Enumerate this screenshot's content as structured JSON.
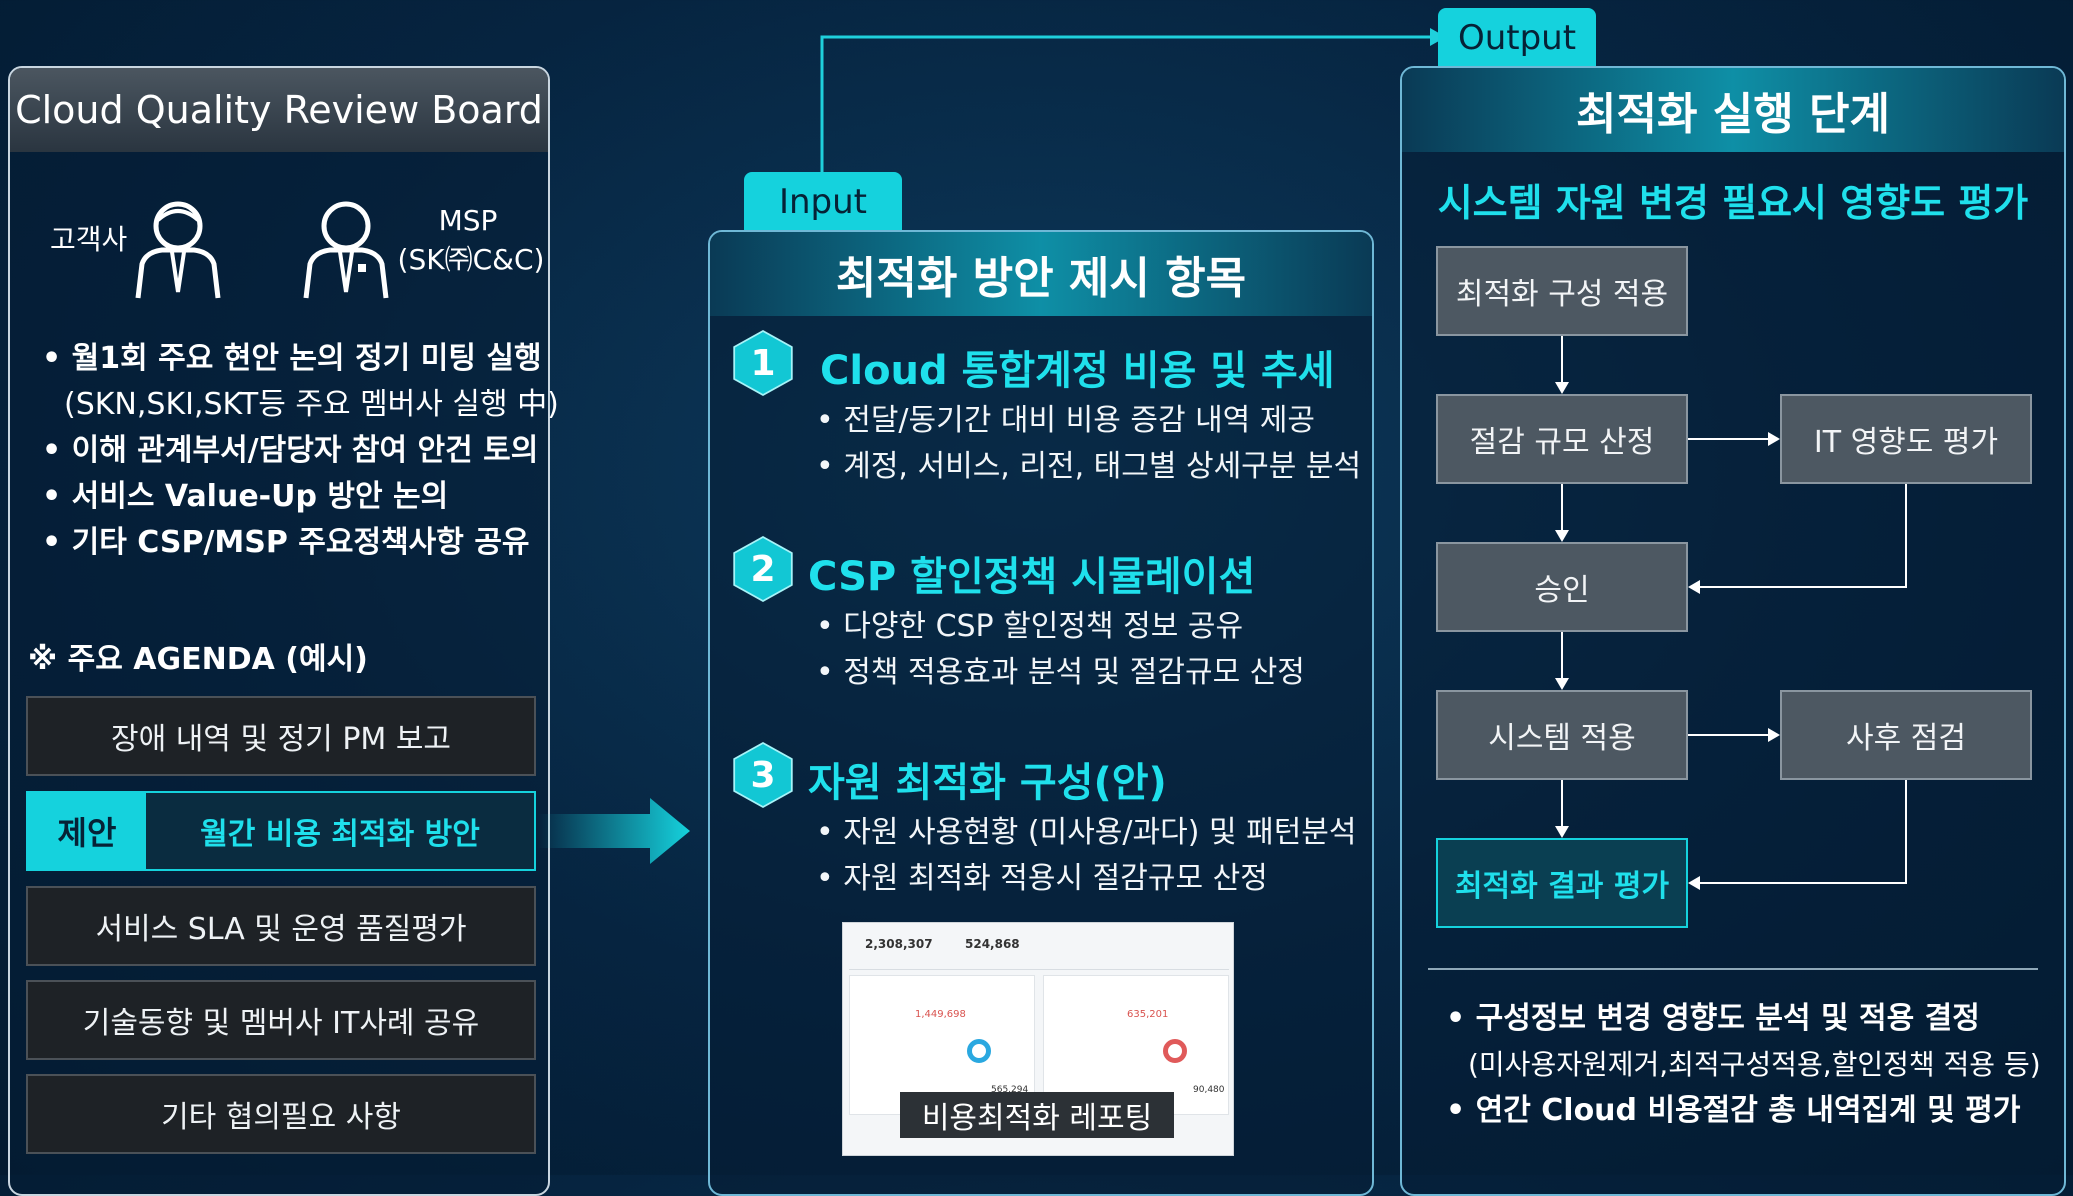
{
  "left": {
    "title": "Cloud Quality Review Board",
    "customer_label": "고객사",
    "msp_label": "MSP",
    "msp_sub": "(SK㈜C&C)",
    "bullets": [
      "• 월1회 주요 현안 논의 정기 미팅 실행",
      "(SKN,SKI,SKT등 주요 멤버사 실행 中)",
      "• 이해 관계부서/담당자 참여 안건 토의",
      "• 서비스 Value-Up 방안 논의",
      "• 기타 CSP/MSP 주요정책사항 공유"
    ],
    "agenda_title": "※ 주요 AGENDA (예시)",
    "agenda": [
      "장애 내역 및 정기 PM 보고",
      "월간 비용 최적화 방안",
      "서비스 SLA 및 운영 품질평가",
      "기술동향 및 멤버사 IT사례 공유",
      "기타 협의필요 사항"
    ],
    "proposal_tag": "제안"
  },
  "middle": {
    "tab": "Input",
    "title": "최적화 방안 제시 항목",
    "sections": [
      {
        "num": "1",
        "head": "Cloud 통합계정 비용 및 추세",
        "items": [
          "• 전달/동기간 대비 비용 증감 내역 제공",
          "• 계정, 서비스, 리전, 태그별 상세구분 분석"
        ]
      },
      {
        "num": "2",
        "head": "CSP 할인정책 시뮬레이션",
        "items": [
          "• 다양한 CSP 할인정책 정보 공유",
          "• 정책 적용효과 분석 및 절감규모 산정"
        ]
      },
      {
        "num": "3",
        "head": "자원 최적화 구성(안)",
        "items": [
          "• 자원 사용현황 (미사용/과다) 및 패턴분석",
          "• 자원 최적화 적용시 절감규모 산정"
        ]
      }
    ],
    "report_caption": "비용최적화 레포팅",
    "report_values": {
      "v1": "2,308,307",
      "v2": "524,868",
      "v3": "1,449,698",
      "v4": "635,201",
      "v5": "565,294",
      "v6": "90,480"
    }
  },
  "right": {
    "tab": "Output",
    "title": "최적화 실행 단계",
    "subtitle": "시스템 자원 변경 필요시 영향도 평가",
    "flow": {
      "b1": "최적화 구성 적용",
      "b2": "절감 규모 산정",
      "b3": "IT 영향도 평가",
      "b4": "승인",
      "b5": "시스템 적용",
      "b6": "사후 점검",
      "b7": "최적화 결과 평가"
    },
    "bullets": [
      "• 구성정보 변경 영향도 분석 및 적용 결정",
      "(미사용자원제거,최적구성적용,할인정책 적용 등)",
      "• 연간 Cloud 비용절감 총 내역집계 및 평가"
    ]
  },
  "colors": {
    "accent": "#15d2dd",
    "box": "#4d5862",
    "dark": "#062440"
  }
}
